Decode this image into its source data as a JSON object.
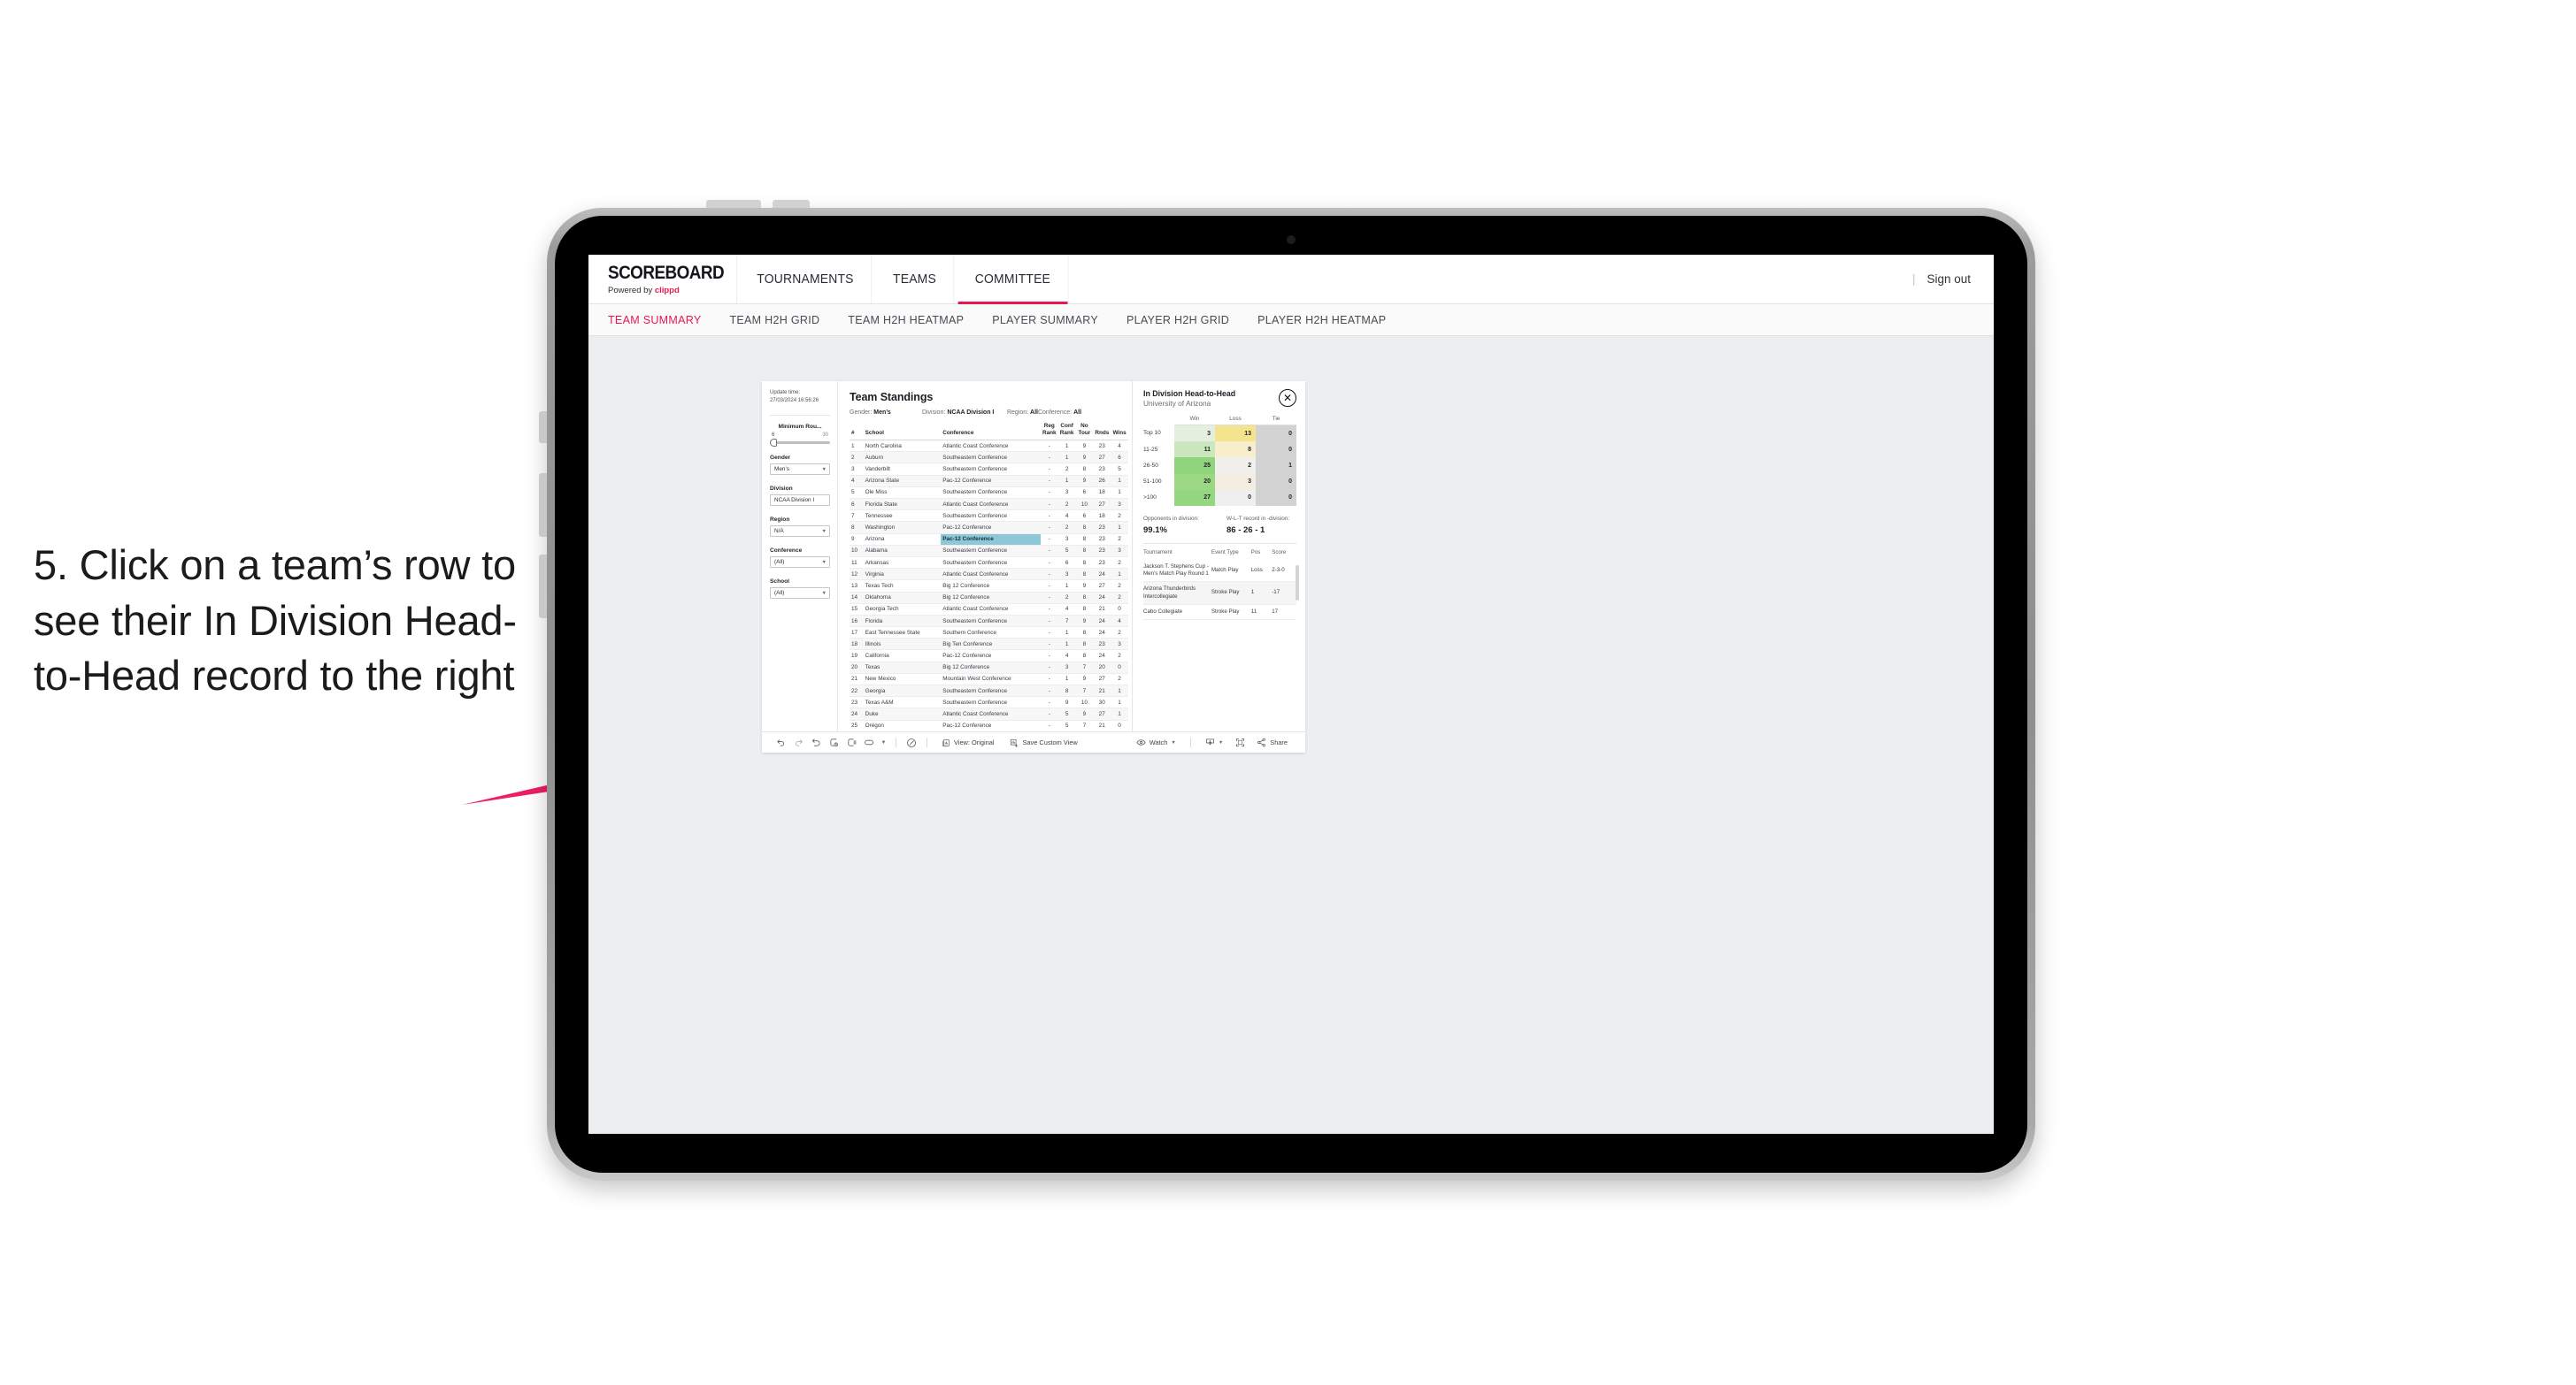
{
  "annotation": {
    "text": "5. Click on a team’s row to see their In Division Head-to-Head record to the right",
    "arrow_color": "#ed1e63"
  },
  "topnav": {
    "brand_title": "SCOREBOARD",
    "brand_powered": "Powered by ",
    "brand_name": "clippd",
    "items": [
      {
        "label": "TOURNAMENTS",
        "active": false
      },
      {
        "label": "TEAMS",
        "active": false
      },
      {
        "label": "COMMITTEE",
        "active": true
      }
    ],
    "divider": "|",
    "signout": "Sign out"
  },
  "subnav": {
    "items": [
      {
        "label": "TEAM SUMMARY",
        "active": true
      },
      {
        "label": "TEAM H2H GRID",
        "active": false
      },
      {
        "label": "TEAM H2H HEATMAP",
        "active": false
      },
      {
        "label": "PLAYER SUMMARY",
        "active": false
      },
      {
        "label": "PLAYER H2H GRID",
        "active": false
      },
      {
        "label": "PLAYER H2H HEATMAP",
        "active": false
      }
    ]
  },
  "rail": {
    "update_label": "Update time:",
    "update_value": "27/03/2024 16:56:26",
    "min_rounds": {
      "title": "Minimum Rou...",
      "min": "6",
      "max": "30"
    },
    "filters": [
      {
        "title": "Gender",
        "value": "Men’s"
      },
      {
        "title": "Division",
        "value": "NCAA Division I"
      },
      {
        "title": "Region",
        "value": "N/A"
      },
      {
        "title": "Conference",
        "value": "(All)"
      },
      {
        "title": "School",
        "value": "(All)"
      }
    ]
  },
  "standings": {
    "title": "Team Standings",
    "crumbs": [
      {
        "key": "Gender: ",
        "value": "Men’s"
      },
      {
        "key": "Division: ",
        "value": "NCAA Division I"
      },
      {
        "key": "Region: ",
        "value": "All"
      },
      {
        "key": "Conference: ",
        "value": "All"
      }
    ],
    "columns": [
      "#",
      "School",
      "Conference",
      "Reg Rank",
      "Conf Rank",
      "No Tour",
      "Rnds",
      "Wins"
    ],
    "rows": [
      {
        "n": "1",
        "school": "North Carolina",
        "conf": "Atlantic Coast Conference",
        "reg": "-",
        "crank": "1",
        "notour": "9",
        "rnds": "23",
        "wins": "4",
        "selected": false
      },
      {
        "n": "2",
        "school": "Auburn",
        "conf": "Southeastern Conference",
        "reg": "-",
        "crank": "1",
        "notour": "9",
        "rnds": "27",
        "wins": "6",
        "selected": false
      },
      {
        "n": "3",
        "school": "Vanderbilt",
        "conf": "Southeastern Conference",
        "reg": "-",
        "crank": "2",
        "notour": "8",
        "rnds": "23",
        "wins": "5",
        "selected": false
      },
      {
        "n": "4",
        "school": "Arizona State",
        "conf": "Pac-12 Conference",
        "reg": "-",
        "crank": "1",
        "notour": "9",
        "rnds": "26",
        "wins": "1",
        "selected": false
      },
      {
        "n": "5",
        "school": "Ole Miss",
        "conf": "Southeastern Conference",
        "reg": "-",
        "crank": "3",
        "notour": "6",
        "rnds": "18",
        "wins": "1",
        "selected": false
      },
      {
        "n": "6",
        "school": "Florida State",
        "conf": "Atlantic Coast Conference",
        "reg": "-",
        "crank": "2",
        "notour": "10",
        "rnds": "27",
        "wins": "3",
        "selected": false
      },
      {
        "n": "7",
        "school": "Tennessee",
        "conf": "Southeastern Conference",
        "reg": "-",
        "crank": "4",
        "notour": "6",
        "rnds": "18",
        "wins": "2",
        "selected": false
      },
      {
        "n": "8",
        "school": "Washington",
        "conf": "Pac-12 Conference",
        "reg": "-",
        "crank": "2",
        "notour": "8",
        "rnds": "23",
        "wins": "1",
        "selected": false
      },
      {
        "n": "9",
        "school": "Arizona",
        "conf": "Pac-12 Conference",
        "reg": "-",
        "crank": "3",
        "notour": "8",
        "rnds": "23",
        "wins": "2",
        "selected": true
      },
      {
        "n": "10",
        "school": "Alabama",
        "conf": "Southeastern Conference",
        "reg": "-",
        "crank": "5",
        "notour": "8",
        "rnds": "23",
        "wins": "3",
        "selected": false
      },
      {
        "n": "11",
        "school": "Arkansas",
        "conf": "Southeastern Conference",
        "reg": "-",
        "crank": "6",
        "notour": "8",
        "rnds": "23",
        "wins": "2",
        "selected": false
      },
      {
        "n": "12",
        "school": "Virginia",
        "conf": "Atlantic Coast Conference",
        "reg": "-",
        "crank": "3",
        "notour": "8",
        "rnds": "24",
        "wins": "1",
        "selected": false
      },
      {
        "n": "13",
        "school": "Texas Tech",
        "conf": "Big 12 Conference",
        "reg": "-",
        "crank": "1",
        "notour": "9",
        "rnds": "27",
        "wins": "2",
        "selected": false
      },
      {
        "n": "14",
        "school": "Oklahoma",
        "conf": "Big 12 Conference",
        "reg": "-",
        "crank": "2",
        "notour": "8",
        "rnds": "24",
        "wins": "2",
        "selected": false
      },
      {
        "n": "15",
        "school": "Georgia Tech",
        "conf": "Atlantic Coast Conference",
        "reg": "-",
        "crank": "4",
        "notour": "8",
        "rnds": "21",
        "wins": "0",
        "selected": false
      },
      {
        "n": "16",
        "school": "Florida",
        "conf": "Southeastern Conference",
        "reg": "-",
        "crank": "7",
        "notour": "9",
        "rnds": "24",
        "wins": "4",
        "selected": false
      },
      {
        "n": "17",
        "school": "East Tennessee State",
        "conf": "Southern Conference",
        "reg": "-",
        "crank": "1",
        "notour": "8",
        "rnds": "24",
        "wins": "2",
        "selected": false
      },
      {
        "n": "18",
        "school": "Illinois",
        "conf": "Big Ten Conference",
        "reg": "-",
        "crank": "1",
        "notour": "8",
        "rnds": "23",
        "wins": "3",
        "selected": false
      },
      {
        "n": "19",
        "school": "California",
        "conf": "Pac-12 Conference",
        "reg": "-",
        "crank": "4",
        "notour": "8",
        "rnds": "24",
        "wins": "2",
        "selected": false
      },
      {
        "n": "20",
        "school": "Texas",
        "conf": "Big 12 Conference",
        "reg": "-",
        "crank": "3",
        "notour": "7",
        "rnds": "20",
        "wins": "0",
        "selected": false
      },
      {
        "n": "21",
        "school": "New Mexico",
        "conf": "Mountain West Conference",
        "reg": "-",
        "crank": "1",
        "notour": "9",
        "rnds": "27",
        "wins": "2",
        "selected": false
      },
      {
        "n": "22",
        "school": "Georgia",
        "conf": "Southeastern Conference",
        "reg": "-",
        "crank": "8",
        "notour": "7",
        "rnds": "21",
        "wins": "1",
        "selected": false
      },
      {
        "n": "23",
        "school": "Texas A&M",
        "conf": "Southeastern Conference",
        "reg": "-",
        "crank": "9",
        "notour": "10",
        "rnds": "30",
        "wins": "1",
        "selected": false
      },
      {
        "n": "24",
        "school": "Duke",
        "conf": "Atlantic Coast Conference",
        "reg": "-",
        "crank": "5",
        "notour": "9",
        "rnds": "27",
        "wins": "1",
        "selected": false
      },
      {
        "n": "25",
        "school": "Oregon",
        "conf": "Pac-12 Conference",
        "reg": "-",
        "crank": "5",
        "notour": "7",
        "rnds": "21",
        "wins": "0",
        "selected": false
      }
    ]
  },
  "panel": {
    "title": "In Division Head-to-Head",
    "subtitle": "University of Arizona",
    "close_icon": "✕",
    "chart_data": {
      "type": "heatmap",
      "title": "In Division Head-to-Head",
      "subtitle": "University of Arizona",
      "columns": [
        "Win",
        "Loss",
        "Tie"
      ],
      "rows": [
        "Top 10",
        "11-25",
        "26-50",
        "51-100",
        ">100"
      ],
      "values": [
        [
          3,
          13,
          0
        ],
        [
          11,
          8,
          0
        ],
        [
          25,
          2,
          1
        ],
        [
          20,
          3,
          0
        ],
        [
          27,
          0,
          0
        ]
      ],
      "cell_colors": [
        [
          "#e4efe0",
          "#f5e48e",
          "#d2d2d2"
        ],
        [
          "#cbe7bd",
          "#f7eecb",
          "#d2d2d2"
        ],
        [
          "#8fd37a",
          "#f1f0ec",
          "#d2d2d2"
        ],
        [
          "#9ad884",
          "#f4eee2",
          "#d2d2d2"
        ],
        [
          "#95d680",
          "#efefef",
          "#d2d2d2"
        ]
      ]
    },
    "stats": [
      {
        "key": "Opponents in division:",
        "value": "99.1%"
      },
      {
        "key": "W-L-T record in -division:",
        "value": "86 - 26 - 1"
      }
    ],
    "events": {
      "columns": [
        "Tournament",
        "Event Type",
        "Pos",
        "Score"
      ],
      "rows": [
        {
          "tournament": "Jackson T. Stephens Cup - Men’s Match Play Round 1",
          "type": "Match Play",
          "pos": "Loss",
          "score": "2-3-0"
        },
        {
          "tournament": "Arizona Thunderbirds Intercollegiate",
          "type": "Stroke Play",
          "pos": "1",
          "score": "-17"
        },
        {
          "tournament": "Cabo Collegiate",
          "type": "Stroke Play",
          "pos": "11",
          "score": "17"
        }
      ]
    }
  },
  "toolbar": {
    "icons": [
      "undo-icon",
      "redo-icon",
      "revert-icon",
      "refresh-icon",
      "pause-icon",
      "highlight-icon"
    ],
    "view_label": "View: Original",
    "save_label": "Save Custom View",
    "watch_label": "Watch",
    "share_label": "Share"
  }
}
